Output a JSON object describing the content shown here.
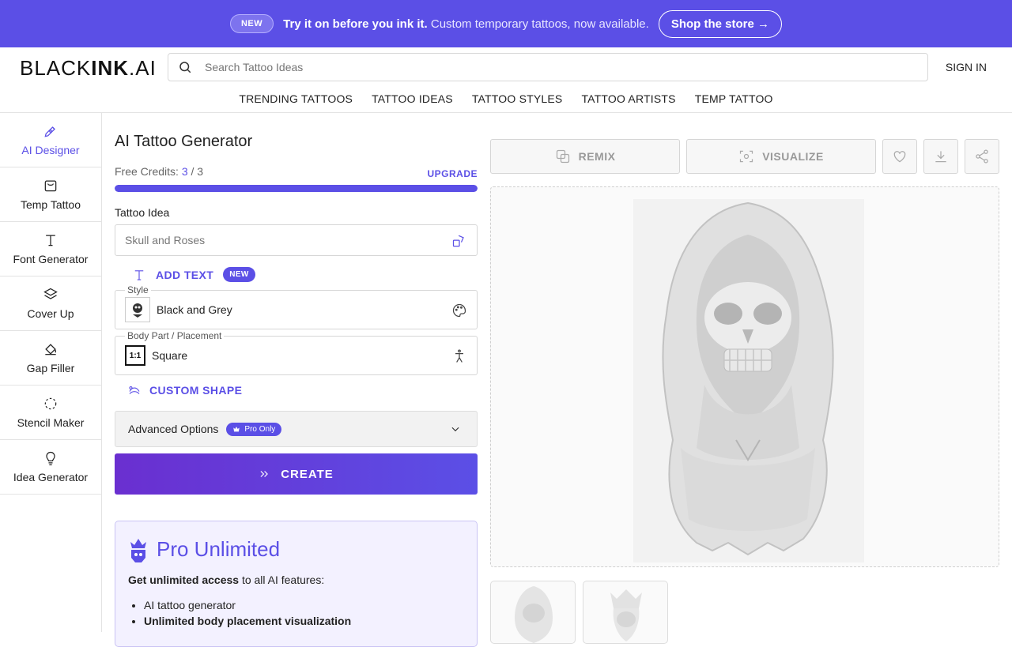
{
  "banner": {
    "badge": "NEW",
    "headline": "Try it on before you ink it.",
    "subline": "Custom temporary tattoos, now available.",
    "cta": "Shop the store →"
  },
  "header": {
    "logo_thin": "BLACK",
    "logo_bold": "INK",
    "logo_tail": ".AI",
    "search_placeholder": "Search Tattoo Ideas",
    "signin": "SIGN IN"
  },
  "nav": [
    "TRENDING TATTOOS",
    "TATTOO IDEAS",
    "TATTOO STYLES",
    "TATTOO ARTISTS",
    "TEMP TATTOO"
  ],
  "sidebar": [
    {
      "label": "AI Designer",
      "icon": "pen-tool-icon",
      "active": true
    },
    {
      "label": "Temp Tattoo",
      "icon": "shopping-bag-icon"
    },
    {
      "label": "Font Generator",
      "icon": "type-icon"
    },
    {
      "label": "Cover Up",
      "icon": "layers-icon"
    },
    {
      "label": "Gap Filler",
      "icon": "paint-bucket-icon"
    },
    {
      "label": "Stencil Maker",
      "icon": "dashed-circle-icon"
    },
    {
      "label": "Idea Generator",
      "icon": "lightbulb-icon"
    }
  ],
  "main": {
    "title": "AI Tattoo Generator",
    "credits_label": "Free Credits:",
    "credits_used": "3",
    "credits_sep": " / ",
    "credits_total": "3",
    "credits_fraction": 1.0,
    "upgrade": "UPGRADE",
    "idea_label": "Tattoo Idea",
    "idea_placeholder": "Skull and Roses",
    "add_text": "ADD TEXT",
    "add_text_badge": "NEW",
    "style_legend": "Style",
    "style_value": "Black and Grey",
    "placement_legend": "Body Part / Placement",
    "placement_value": "Square",
    "placement_icon_text": "1:1",
    "custom_shape": "CUSTOM SHAPE",
    "advanced": "Advanced Options",
    "pro_only": "Pro Only",
    "create": "CREATE"
  },
  "pro": {
    "title": "Pro Unlimited",
    "desc_bold": "Get unlimited access",
    "desc_rest": " to all AI features:",
    "items": [
      "AI tattoo generator",
      "Unlimited body placement visualization"
    ]
  },
  "toolbar": {
    "remix": "REMIX",
    "visualize": "VISUALIZE"
  },
  "colors": {
    "accent": "#5b4fe6",
    "banner": "#5b4fe6"
  }
}
